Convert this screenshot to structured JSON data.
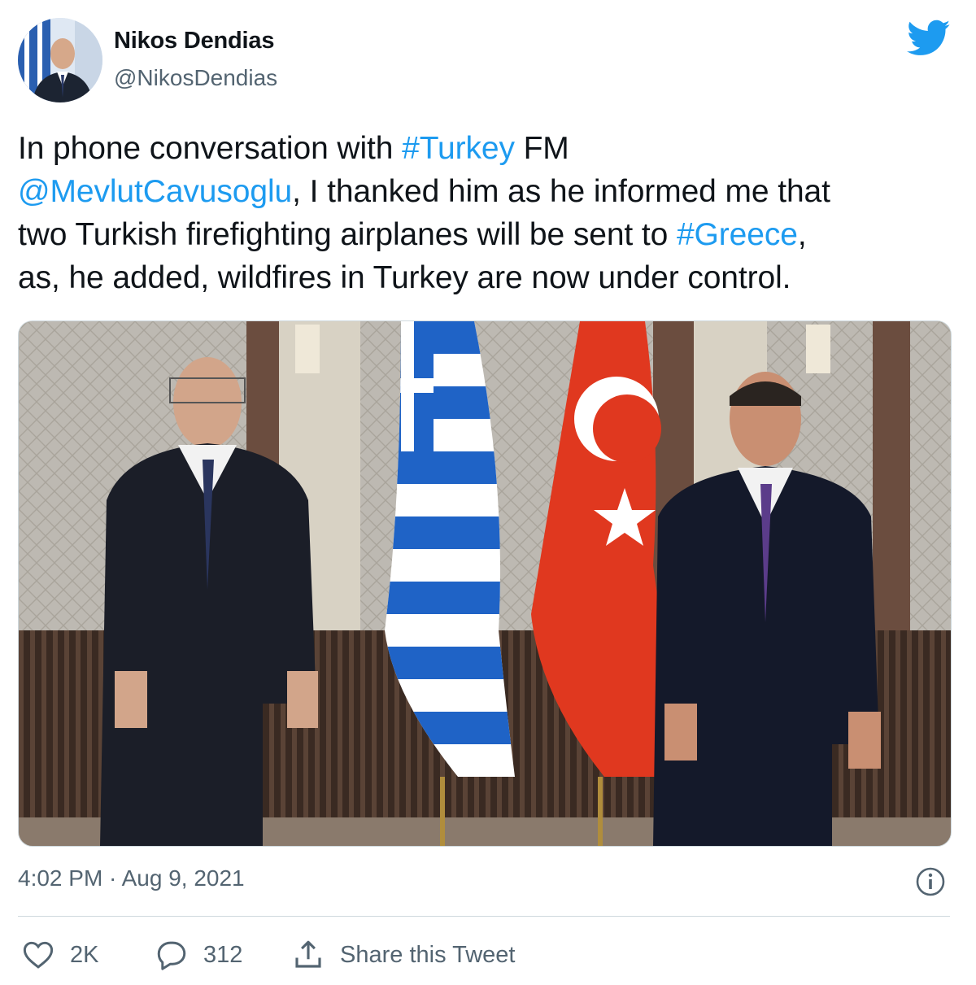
{
  "author": {
    "name": "Nikos Dendias",
    "handle": "@NikosDendias"
  },
  "tweet": {
    "line1_a": "In phone conversation with ",
    "line1_hashtag": "#Turkey",
    "line1_b": " FM",
    "line2_mention": "@MevlutCavusoglu",
    "line2_b": ", I thanked him as he informed me that",
    "line3_a": "two Turkish firefighting airplanes will be sent to ",
    "line3_hashtag": "#Greece",
    "line3_b": ",",
    "line4": "as, he added, wildfires in Turkey are now under control."
  },
  "meta": {
    "timestamp": "4:02 PM · Aug 9, 2021"
  },
  "actions": {
    "likes": "2K",
    "replies": "312",
    "share_label": "Share this Tweet"
  },
  "colors": {
    "link": "#1d9bf0",
    "twitter_blue": "#1d9bf0",
    "secondary_text": "#536471",
    "greek_flag_blue": "#1f63c6",
    "turkish_flag_red": "#e0381f"
  },
  "icons": {
    "brand": "twitter-bird-icon",
    "info": "info-icon",
    "like": "heart-icon",
    "reply": "speech-bubble-icon",
    "share": "share-upload-icon"
  }
}
